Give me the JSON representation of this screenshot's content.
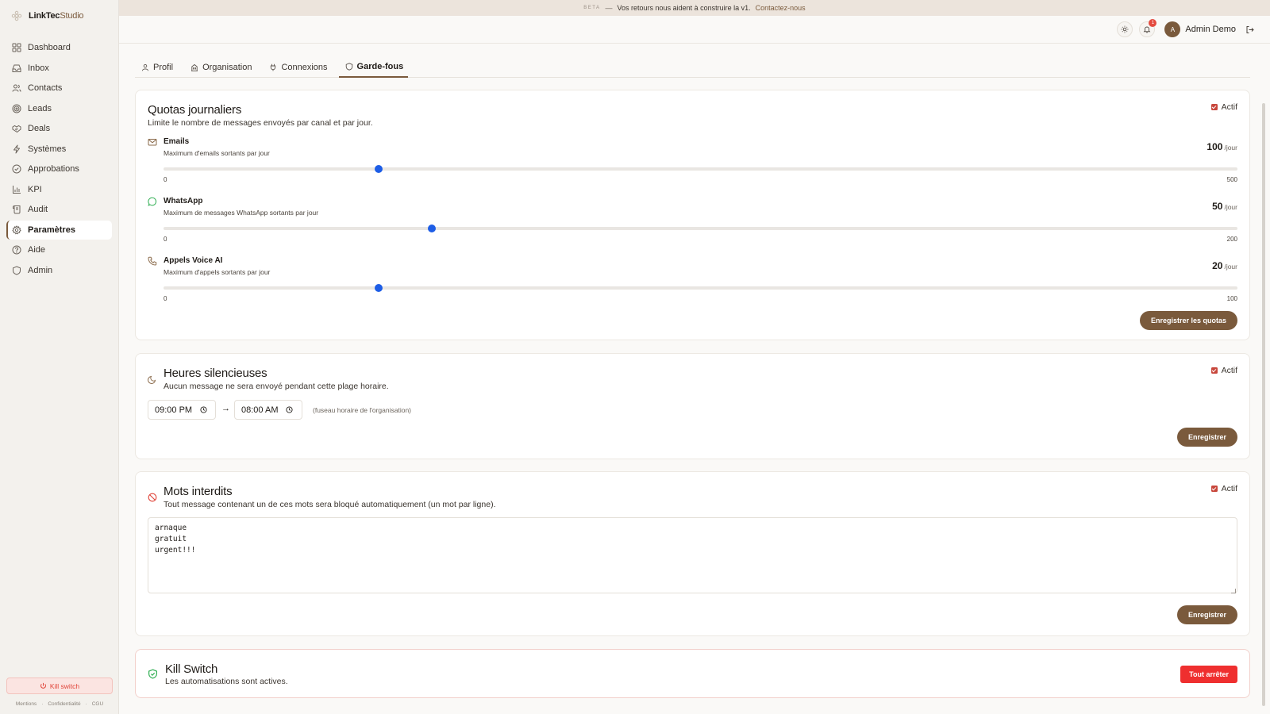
{
  "app": {
    "brand_main": "LinkTec",
    "brand_accent": "Studio"
  },
  "sidebar": {
    "items": [
      {
        "label": "Dashboard"
      },
      {
        "label": "Inbox"
      },
      {
        "label": "Contacts"
      },
      {
        "label": "Leads"
      },
      {
        "label": "Deals"
      },
      {
        "label": "Systèmes"
      },
      {
        "label": "Approbations"
      },
      {
        "label": "KPI"
      },
      {
        "label": "Audit"
      },
      {
        "label": "Paramètres"
      },
      {
        "label": "Aide"
      },
      {
        "label": "Admin"
      }
    ],
    "active": "Paramètres",
    "kill_switch_label": "Kill switch",
    "legal": [
      "Mentions",
      "Confidentialité",
      "CGU"
    ],
    "legal_sep": "·"
  },
  "banner": {
    "beta": "BETA",
    "dash": "—",
    "text": "Vos retours nous aident à construire la v1.",
    "link": "Contactez-nous"
  },
  "header": {
    "notification_count": "1",
    "avatar_initial": "A",
    "user_name": "Admin Demo"
  },
  "tabs": [
    {
      "label": "Profil"
    },
    {
      "label": "Organisation"
    },
    {
      "label": "Connexions"
    },
    {
      "label": "Garde-fous"
    }
  ],
  "active_tab": "Garde-fous",
  "quotas": {
    "title": "Quotas journaliers",
    "description": "Limite le nombre de messages envoyés par canal et par jour.",
    "active_label": "Actif",
    "unit": "/jour",
    "save_label": "Enregistrer les quotas",
    "rows": [
      {
        "label": "Emails",
        "sub": "Maximum d'emails sortants par jour",
        "value": "100",
        "min": "0",
        "max": "500",
        "fraction": 0.2
      },
      {
        "label": "WhatsApp",
        "sub": "Maximum de messages WhatsApp sortants par jour",
        "value": "50",
        "min": "0",
        "max": "200",
        "fraction": 0.25
      },
      {
        "label": "Appels Voice AI",
        "sub": "Maximum d'appels sortants par jour",
        "value": "20",
        "min": "0",
        "max": "100",
        "fraction": 0.2
      }
    ]
  },
  "quiet_hours": {
    "title": "Heures silencieuses",
    "description": "Aucun message ne sera envoyé pendant cette plage horaire.",
    "active_label": "Actif",
    "start": "09:00 PM",
    "arrow": "→",
    "end": "08:00 AM",
    "hint": "(fuseau horaire de l'organisation)",
    "save_label": "Enregistrer"
  },
  "banned_words": {
    "title": "Mots interdits",
    "description": "Tout message contenant un de ces mots sera bloqué automatiquement (un mot par ligne).",
    "active_label": "Actif",
    "words": "arnaque\ngratuit\nurgent!!!",
    "save_label": "Enregistrer"
  },
  "kill_switch": {
    "title": "Kill Switch",
    "status": "Les automatisations sont actives.",
    "button_label": "Tout arrêter"
  },
  "colors": {
    "accent": "#7a5a3c",
    "slider_thumb": "#1d5de6",
    "danger": "#ef2f2f",
    "checkbox": "#c8473c"
  }
}
